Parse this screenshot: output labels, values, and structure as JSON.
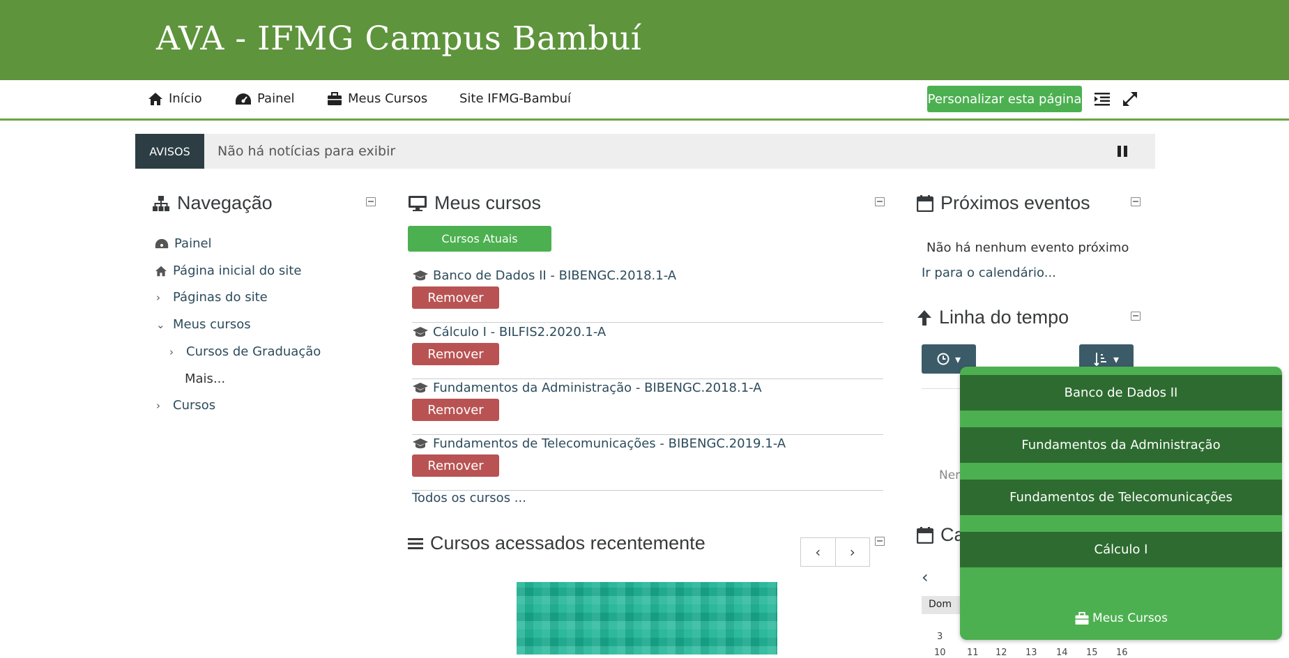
{
  "site_title": "AVA - IFMG Campus Bambuí",
  "navbar": {
    "items": [
      {
        "label": "Início",
        "icon": "home-icon"
      },
      {
        "label": "Painel",
        "icon": "dashboard-icon"
      },
      {
        "label": "Meus Cursos",
        "icon": "briefcase-icon"
      },
      {
        "label": "Site IFMG-Bambuí",
        "icon": ""
      }
    ],
    "customize_label": "Personalizar esta página"
  },
  "avisos": {
    "label": "AVISOS",
    "message": "Não há notícias para exibir"
  },
  "navigation": {
    "title": "Navegação",
    "items": [
      {
        "label": "Painel"
      },
      {
        "label": "Página inicial do site"
      },
      {
        "label": "Páginas do site"
      },
      {
        "label": "Meus cursos"
      },
      {
        "label": "Cursos de Graduação"
      },
      {
        "label": "Mais..."
      },
      {
        "label": "Cursos"
      }
    ]
  },
  "my_courses": {
    "title": "Meus cursos",
    "current_tab": "Cursos Atuais",
    "remove_label": "Remover",
    "courses": [
      {
        "name": "Banco de Dados II - BIBENGC.2018.1-A"
      },
      {
        "name": "Cálculo I - BILFIS2.2020.1-A"
      },
      {
        "name": "Fundamentos da Administração - BIBENGC.2018.1-A"
      },
      {
        "name": "Fundamentos de Telecomunicações - BIBENGC.2019.1-A"
      }
    ],
    "all_courses": "Todos os cursos ..."
  },
  "recent_courses": {
    "title": "Cursos acessados recentemente"
  },
  "upcoming_events": {
    "title": "Próximos eventos",
    "empty_text": "Não há nenhum evento próximo",
    "calendar_link": "Ir para o calendário..."
  },
  "timeline": {
    "title": "Linha do tempo",
    "partial_text": "Nen"
  },
  "calendar": {
    "partial_title": "Ca",
    "day_header": "Dom",
    "row1": [
      "3"
    ],
    "row2": [
      "10",
      "11",
      "12",
      "13",
      "14",
      "15",
      "16"
    ]
  },
  "popup": {
    "items": [
      "Banco de Dados II",
      "Fundamentos da Administração",
      "Fundamentos de Telecomunicações",
      "Cálculo I"
    ],
    "footer_label": "Meus Cursos"
  },
  "colors": {
    "banner": "#5e943c",
    "accent": "#4cb050",
    "danger": "#b95353",
    "popup_item": "#2e6b30"
  }
}
